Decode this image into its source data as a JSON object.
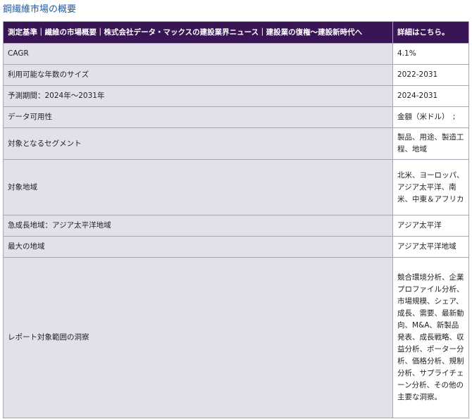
{
  "page": {
    "title": "鋼繊維市場の概要"
  },
  "table": {
    "header": {
      "left": "測定基準｜繊維の市場概要｜株式会社データ・マックスの建設業界ニュース｜建設業の復権〜建設新時代へ",
      "right": "詳細はこちら。"
    },
    "rows": [
      {
        "label": "CAGR",
        "value": "4.1%"
      },
      {
        "label": "利用可能な年数のサイズ",
        "value": "2022-2031"
      },
      {
        "label": "予測期間：2024年〜2031年",
        "value": "2024-2031"
      },
      {
        "label": "データ可用性",
        "value": "金額（米ドル）　;"
      },
      {
        "label": "対象となるセグメント",
        "value": "製品、用途、製造工程、地域"
      },
      {
        "label": "対象地域",
        "value": "北米、ヨーロッパ、アジア太平洋、南米、中東＆アフリカ"
      },
      {
        "label": "急成長地域：アジア太平洋地域",
        "value": "アジア太平洋"
      },
      {
        "label": "最大の地域",
        "value": "アジア太平洋地域"
      },
      {
        "label": "レポート対象範囲の洞察",
        "value": "競合環境分析、企業プロファイル分析、市場規模、シェア、成長、需要、最新動向、M&A、新製品発表、成長戦略、収益分析、ポーター分析、価格分析、規制分析、サプライチェーン分析、その他の主要な洞察。"
      }
    ]
  }
}
